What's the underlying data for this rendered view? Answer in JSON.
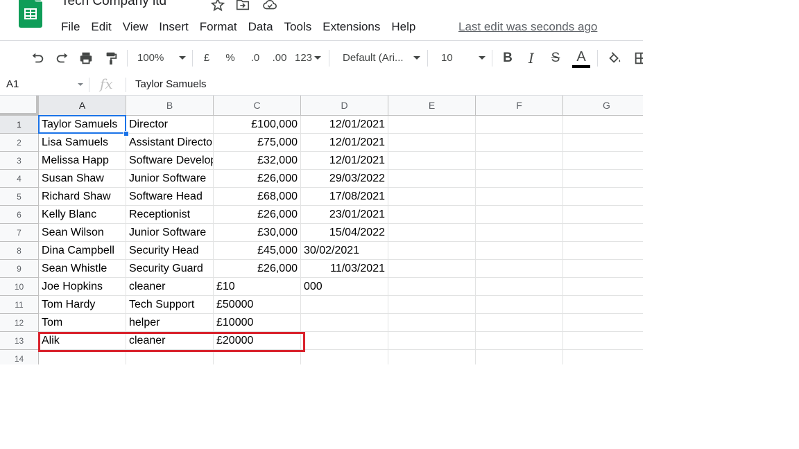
{
  "doc": {
    "title": "Tech Company ltd"
  },
  "menu": [
    "File",
    "Edit",
    "View",
    "Insert",
    "Format",
    "Data",
    "Tools",
    "Extensions",
    "Help"
  ],
  "last_edit": "Last edit was seconds ago",
  "toolbar": {
    "zoom": "100%",
    "currency": "£",
    "percent": "%",
    "decrease_decimal": ".0",
    "increase_decimal": ".00",
    "more_formats": "123",
    "font": "Default (Ari...",
    "font_size": "10",
    "bold": "B",
    "italic": "I",
    "strikethrough": "S",
    "text_color": "A",
    "text_color_value": "#000000"
  },
  "formula_bar": {
    "name_box": "A1",
    "fx": "fx",
    "value": "Taylor Samuels"
  },
  "columns": [
    "A",
    "B",
    "C",
    "D",
    "E",
    "F",
    "G"
  ],
  "rows": [
    {
      "num": "1",
      "cells": [
        "Taylor Samuels",
        "Director",
        "£100,000",
        "12/01/2021",
        "",
        "",
        ""
      ]
    },
    {
      "num": "2",
      "cells": [
        "Lisa Samuels",
        "Assistant Director",
        "£75,000",
        "12/01/2021",
        "",
        "",
        ""
      ]
    },
    {
      "num": "3",
      "cells": [
        "Melissa Happ",
        "Software Developer",
        "£32,000",
        "12/01/2021",
        "",
        "",
        ""
      ]
    },
    {
      "num": "4",
      "cells": [
        "Susan Shaw",
        "Junior Software",
        "£26,000",
        "29/03/2022",
        "",
        "",
        ""
      ]
    },
    {
      "num": "5",
      "cells": [
        "Richard Shaw",
        "Software Head",
        "£68,000",
        "17/08/2021",
        "",
        "",
        ""
      ]
    },
    {
      "num": "6",
      "cells": [
        "Kelly Blanc",
        "Receptionist",
        "£26,000",
        "23/01/2021",
        "",
        "",
        ""
      ]
    },
    {
      "num": "7",
      "cells": [
        "Sean Wilson",
        "Junior Software",
        "£30,000",
        "15/04/2022",
        "",
        "",
        ""
      ]
    },
    {
      "num": "8",
      "cells": [
        "Dina Campbell",
        "Security Head",
        "£45,000",
        "30/02/2021",
        "",
        "",
        ""
      ]
    },
    {
      "num": "9",
      "cells": [
        "Sean Whistle",
        "Security Guard",
        "£26,000",
        "11/03/2021",
        "",
        "",
        ""
      ]
    },
    {
      "num": "10",
      "cells": [
        "Joe Hopkins",
        " cleaner",
        "£10",
        "000",
        "",
        "",
        ""
      ]
    },
    {
      "num": "11",
      "cells": [
        "Tom Hardy",
        " Tech Support",
        "£50000",
        "",
        "",
        "",
        ""
      ]
    },
    {
      "num": "12",
      "cells": [
        "Tom",
        " helper",
        "£10000",
        "",
        "",
        "",
        ""
      ]
    },
    {
      "num": "13",
      "cells": [
        "Alik",
        "cleaner",
        "£20000",
        "",
        "",
        "",
        ""
      ]
    },
    {
      "num": "14",
      "cells": [
        "",
        "",
        "",
        "",
        "",
        "",
        ""
      ]
    }
  ],
  "colors": {
    "selection": "#1a73e8",
    "highlight_box": "#d9232d",
    "sheets_green": "#0f9d58"
  }
}
